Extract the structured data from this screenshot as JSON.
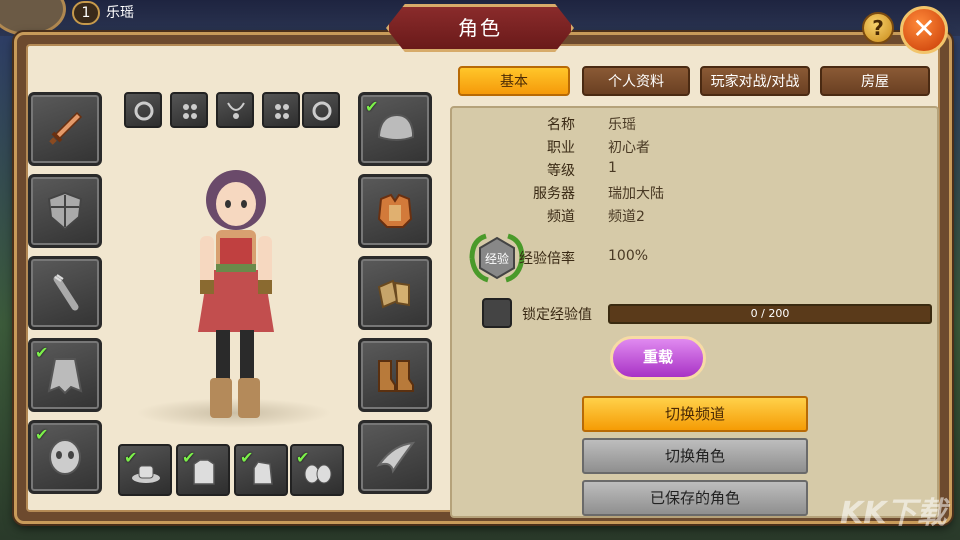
{
  "topbar": {
    "level": "1",
    "player_name": "乐瑶"
  },
  "window": {
    "title": "角色",
    "help_label": "?",
    "close_label": "✕"
  },
  "tabs": [
    {
      "label": "基本",
      "active": true
    },
    {
      "label": "个人资料",
      "active": false
    },
    {
      "label": "玩家对战/对战",
      "active": false
    },
    {
      "label": "房屋",
      "active": false
    }
  ],
  "info": {
    "rows": [
      {
        "label": "名称",
        "value": "乐瑶"
      },
      {
        "label": "职业",
        "value": "初心者"
      },
      {
        "label": "等级",
        "value": "1"
      },
      {
        "label": "服务器",
        "value": "瑞加大陆"
      },
      {
        "label": "频道",
        "value": "频道2"
      }
    ],
    "exp_badge": "经验",
    "exp_rate_label": "经验倍率",
    "exp_rate_value": "100%",
    "lock_exp_label": "锁定经验值",
    "exp_current": 0,
    "exp_max": 200,
    "exp_text": "0 / 200"
  },
  "buttons": {
    "reload": "重载",
    "switch_channel": "切换频道",
    "switch_character": "切换角色",
    "saved_characters": "已保存的角色"
  },
  "equipment": {
    "left_slots": [
      {
        "icon": "sword-icon",
        "checked": false
      },
      {
        "icon": "shield-icon",
        "checked": false
      },
      {
        "icon": "quiver-icon",
        "checked": false
      },
      {
        "icon": "cape-icon",
        "checked": true
      },
      {
        "icon": "mask-icon",
        "checked": true
      }
    ],
    "right_slots": [
      {
        "icon": "cap-icon",
        "checked": true
      },
      {
        "icon": "armor-icon",
        "checked": false
      },
      {
        "icon": "gloves-icon",
        "checked": false
      },
      {
        "icon": "boots-icon",
        "checked": false
      },
      {
        "icon": "wings-icon",
        "checked": false
      }
    ],
    "accessory_slots": [
      "ring-icon",
      "earring-icon",
      "necklace-icon",
      "earring-icon",
      "ring-icon"
    ],
    "cosmetic_slots": [
      {
        "icon": "hat-icon",
        "checked": true
      },
      {
        "icon": "shirt-icon",
        "checked": true
      },
      {
        "icon": "glove-icon",
        "checked": true
      },
      {
        "icon": "shoes-icon",
        "checked": true
      }
    ]
  },
  "watermark": "KK下载",
  "colors": {
    "frame": "#6d4a2e",
    "panel": "#d6caa8",
    "tab_active": "#f59a0a",
    "reload": "#a832c5"
  }
}
